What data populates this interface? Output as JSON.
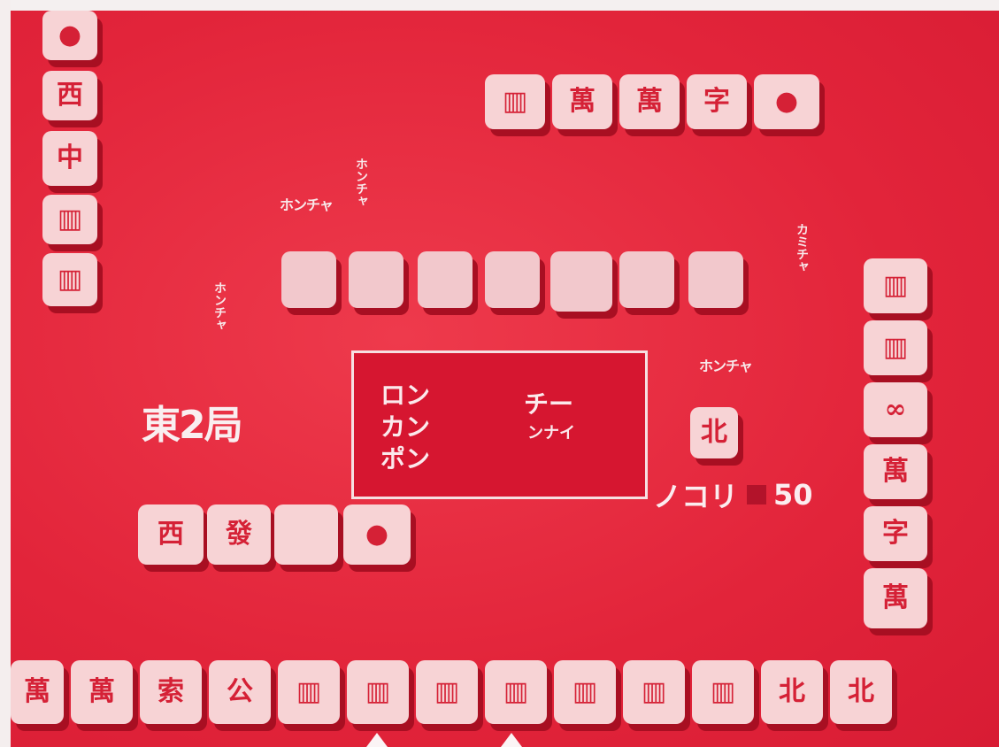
{
  "table": {
    "round_label": "東2局",
    "remaining_label": "ノコリ",
    "remaining_count": "50"
  },
  "dialog": {
    "options": [
      "ロン",
      "カン",
      "ポン",
      "チー",
      "ンナイ"
    ]
  },
  "labels": {
    "left_player": "ホンチャ",
    "top_left": "ホンチャ",
    "top_right": "カミチャ",
    "right_player": "ホンチャ"
  },
  "tiles": {
    "left_column": [
      "●",
      "西",
      "中",
      "▥",
      "▥"
    ],
    "top_melds": [
      "▥",
      "萬",
      "萬",
      "字",
      "●"
    ],
    "opponent_hand_count": 7,
    "right_column": [
      "▥",
      "▥",
      "∞",
      "萬",
      "字",
      "萬"
    ],
    "center_discard": "北",
    "lower_melds": [
      "西",
      "發",
      "",
      "●"
    ],
    "player_hand": [
      "萬",
      "萬",
      "索",
      "公",
      "▥",
      "▥",
      "▥",
      "▥",
      "▥",
      "▥",
      "▥",
      "北",
      "北"
    ]
  }
}
